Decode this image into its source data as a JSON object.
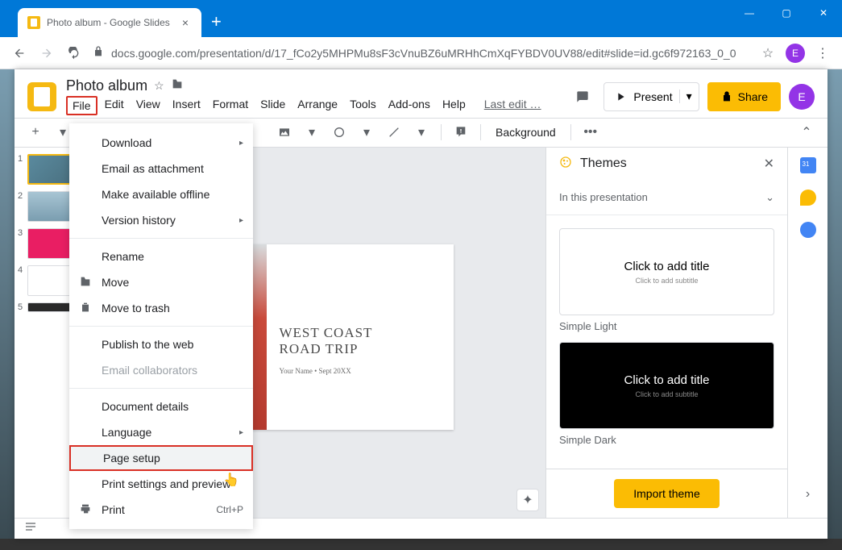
{
  "browser": {
    "tab_title": "Photo album - Google Slides",
    "url": "docs.google.com/presentation/d/17_fCo2y5MHPMu8sF3cVnuBZ6uMRHhCmXqFYBDV0UV88/edit#slide=id.gc6f972163_0_0",
    "avatar_letter": "E"
  },
  "app": {
    "title": "Photo album",
    "menus": [
      "File",
      "Edit",
      "View",
      "Insert",
      "Format",
      "Slide",
      "Arrange",
      "Tools",
      "Add-ons",
      "Help"
    ],
    "last_edit": "Last edit …",
    "present": "Present",
    "share": "Share",
    "avatar_letter": "E"
  },
  "toolbar": {
    "background": "Background"
  },
  "slides": [
    {
      "num": "1"
    },
    {
      "num": "2"
    },
    {
      "num": "3"
    },
    {
      "num": "4"
    },
    {
      "num": "5"
    }
  ],
  "canvas": {
    "title_line1": "WEST COAST",
    "title_line2": "ROAD TRIP",
    "subtitle": "Your Name • Sept 20XX"
  },
  "themes": {
    "panel_title": "Themes",
    "selector": "In this presentation",
    "preview_title": "Click to add title",
    "preview_sub": "Click to add subtitle",
    "items": [
      "Simple Light",
      "Simple Dark"
    ],
    "import": "Import theme"
  },
  "filemenu": {
    "download": "Download",
    "email_attach": "Email as attachment",
    "offline": "Make available offline",
    "version": "Version history",
    "rename": "Rename",
    "move": "Move",
    "trash": "Move to trash",
    "publish": "Publish to the web",
    "email_collab": "Email collaborators",
    "doc_details": "Document details",
    "language": "Language",
    "page_setup": "Page setup",
    "print_preview": "Print settings and preview",
    "print": "Print",
    "print_key": "Ctrl+P"
  }
}
